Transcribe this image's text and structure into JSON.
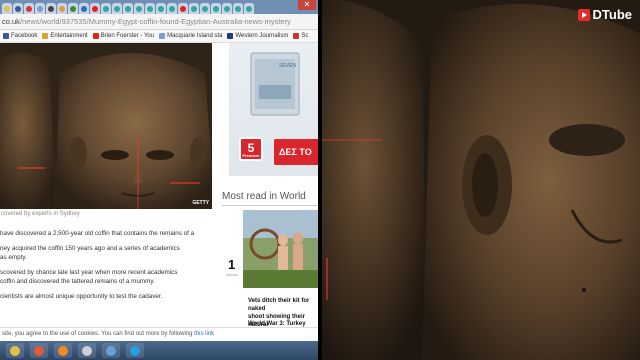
{
  "browser": {
    "close_glyph": "✕",
    "url": {
      "domain": "co.uk",
      "path": "/news/world/937535/Mummy-Egypt-coffin-found-Egyptian-Australia-news-mystery"
    },
    "bookmarks": [
      {
        "label": "Facebook",
        "icon": "facebook-icon",
        "color": "#3b5998"
      },
      {
        "label": "Entertainment",
        "icon": "bookmark-icon",
        "color": "#e0a030"
      },
      {
        "label": "Brien Foerster - You",
        "icon": "youtube-icon",
        "color": "#e62117"
      },
      {
        "label": "Macquarie Island sta",
        "icon": "bookmark-icon",
        "color": "#7c9ccf"
      },
      {
        "label": "Western Journalism",
        "icon": "bookmark-icon",
        "color": "#1a3d7c"
      },
      {
        "label": "Sc",
        "icon": "bookmark-icon",
        "color": "#cc3333"
      }
    ]
  },
  "article": {
    "photo_credit": "GETTY",
    "caption": "covered by experts in Sydney",
    "paragraphs": [
      "have discovered a 2,500-year old coffin that contains the remains of a",
      "ney acquired the coffin 150 years ago and a series of academics\nas empty.",
      "scovered by chance late last year when more recent academics\ncoffin and discovered the tattered remains of a mummy.",
      "cientists are almost unique opportunity to test the cadaver."
    ]
  },
  "ad": {
    "badge_number": "5",
    "badge_sub": "Premium",
    "cta_label": "ΔΕΣ ΤΟ",
    "brand": "SEVEN"
  },
  "sidebar": {
    "heading": "Most read in World",
    "items": [
      {
        "rank": "1",
        "shares": "shares",
        "headline": "Vets ditch their kit for naked\nshoot showing their natural"
      }
    ],
    "next_headline": "World War 3: Turkey"
  },
  "cookie": {
    "text": "site, you agree to the use of cookies. You can find out more by following ",
    "link": "this link"
  },
  "taskbar": {
    "apps": [
      {
        "name": "chrome-taskbar-button",
        "color": "#e0c14b"
      },
      {
        "name": "media-taskbar-button",
        "color": "#e05a3a"
      },
      {
        "name": "firefox-taskbar-button",
        "color": "#f08a24"
      },
      {
        "name": "app-taskbar-button",
        "color": "#c9d0d8"
      },
      {
        "name": "folder-taskbar-button",
        "color": "#6aa0d8"
      },
      {
        "name": "skype-taskbar-button",
        "color": "#1ea1e6"
      }
    ]
  },
  "video": {
    "brand": "DTube"
  }
}
